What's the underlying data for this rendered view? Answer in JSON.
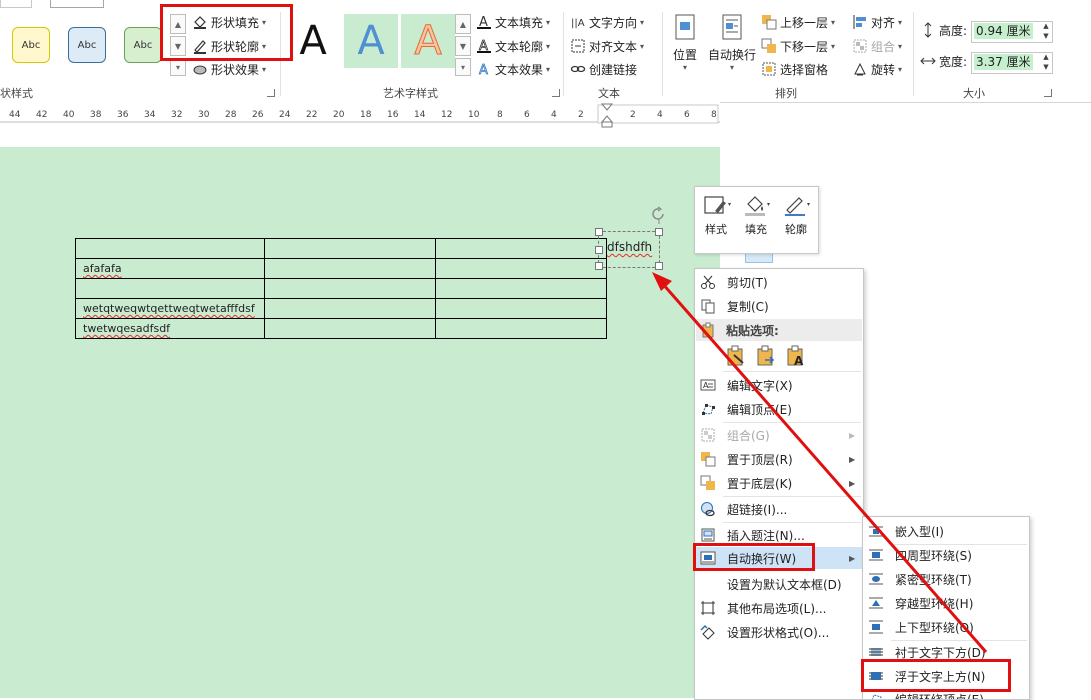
{
  "ribbon": {
    "tab_fragments": [
      "",
      ""
    ],
    "shape_styles": {
      "gallery_items": [
        "Abc",
        "Abc",
        "Abc"
      ],
      "group_label": "状样式",
      "shape_fill": "形状填充",
      "shape_outline": "形状轮廓",
      "shape_effects": "形状效果"
    },
    "wordart": {
      "letters": [
        "A",
        "A",
        "A"
      ],
      "text_fill": "文本填充",
      "text_outline": "文本轮廓",
      "text_effects": "文本效果",
      "group_label": "艺术字样式"
    },
    "text": {
      "text_direction": "文字方向",
      "align_text": "对齐文本",
      "create_link": "创建链接",
      "group_label": "文本"
    },
    "arrange": {
      "position": "位置",
      "wrap_text": "自动换行",
      "bring_forward": "上移一层",
      "send_backward": "下移一层",
      "selection_pane": "选择窗格",
      "align": "对齐",
      "group": "组合",
      "rotate": "旋转",
      "group_label": "排列"
    },
    "size": {
      "height_label": "高度:",
      "height_value": "0.94 厘米",
      "width_label": "宽度:",
      "width_value": "3.37 厘米",
      "group_label": "大小"
    }
  },
  "ruler": {
    "numbers": [
      "44",
      "42",
      "40",
      "38",
      "36",
      "34",
      "32",
      "30",
      "28",
      "26",
      "24",
      "22",
      "20",
      "18",
      "16",
      "14",
      "12",
      "10",
      "8",
      "6",
      "4",
      "2",
      "2",
      "4",
      "6",
      "8"
    ]
  },
  "document": {
    "table_rows": [
      [
        "",
        "",
        ""
      ],
      [
        "afafafa",
        "",
        ""
      ],
      [
        "",
        "",
        ""
      ],
      [
        "wetqtweqwtqettweqtwetafffdsf",
        "",
        ""
      ],
      [
        "twetwqesadfsdf",
        "",
        ""
      ]
    ],
    "textbox_text": "dfshdfh"
  },
  "mini_toolbar": {
    "style": "样式",
    "fill": "填充",
    "outline": "轮廓"
  },
  "context_menu": {
    "cut": "剪切(T)",
    "copy": "复制(C)",
    "paste_options": "粘贴选项:",
    "edit_text": "编辑文字(X)",
    "edit_points": "编辑顶点(E)",
    "group": "组合(G)",
    "bring_to_front": "置于顶层(R)",
    "send_to_back": "置于底层(K)",
    "hyperlink": "超链接(I)...",
    "insert_caption": "插入题注(N)...",
    "wrap_text": "自动换行(W)",
    "set_default_textbox": "设置为默认文本框(D)",
    "more_layout": "其他布局选项(L)...",
    "format_shape": "设置形状格式(O)..."
  },
  "wrap_submenu": {
    "items": [
      "嵌入型(I)",
      "四周型环绕(S)",
      "紧密型环绕(T)",
      "穿越型环绕(H)",
      "上下型环绕(O)",
      "衬于文字下方(D)",
      "浮于文字上方(N)",
      "编辑环绕顶点(E)"
    ]
  },
  "colors": {
    "page_bg": "#c9ebcf",
    "highlight": "#e01010",
    "menu_hover": "#cfe3f7"
  }
}
